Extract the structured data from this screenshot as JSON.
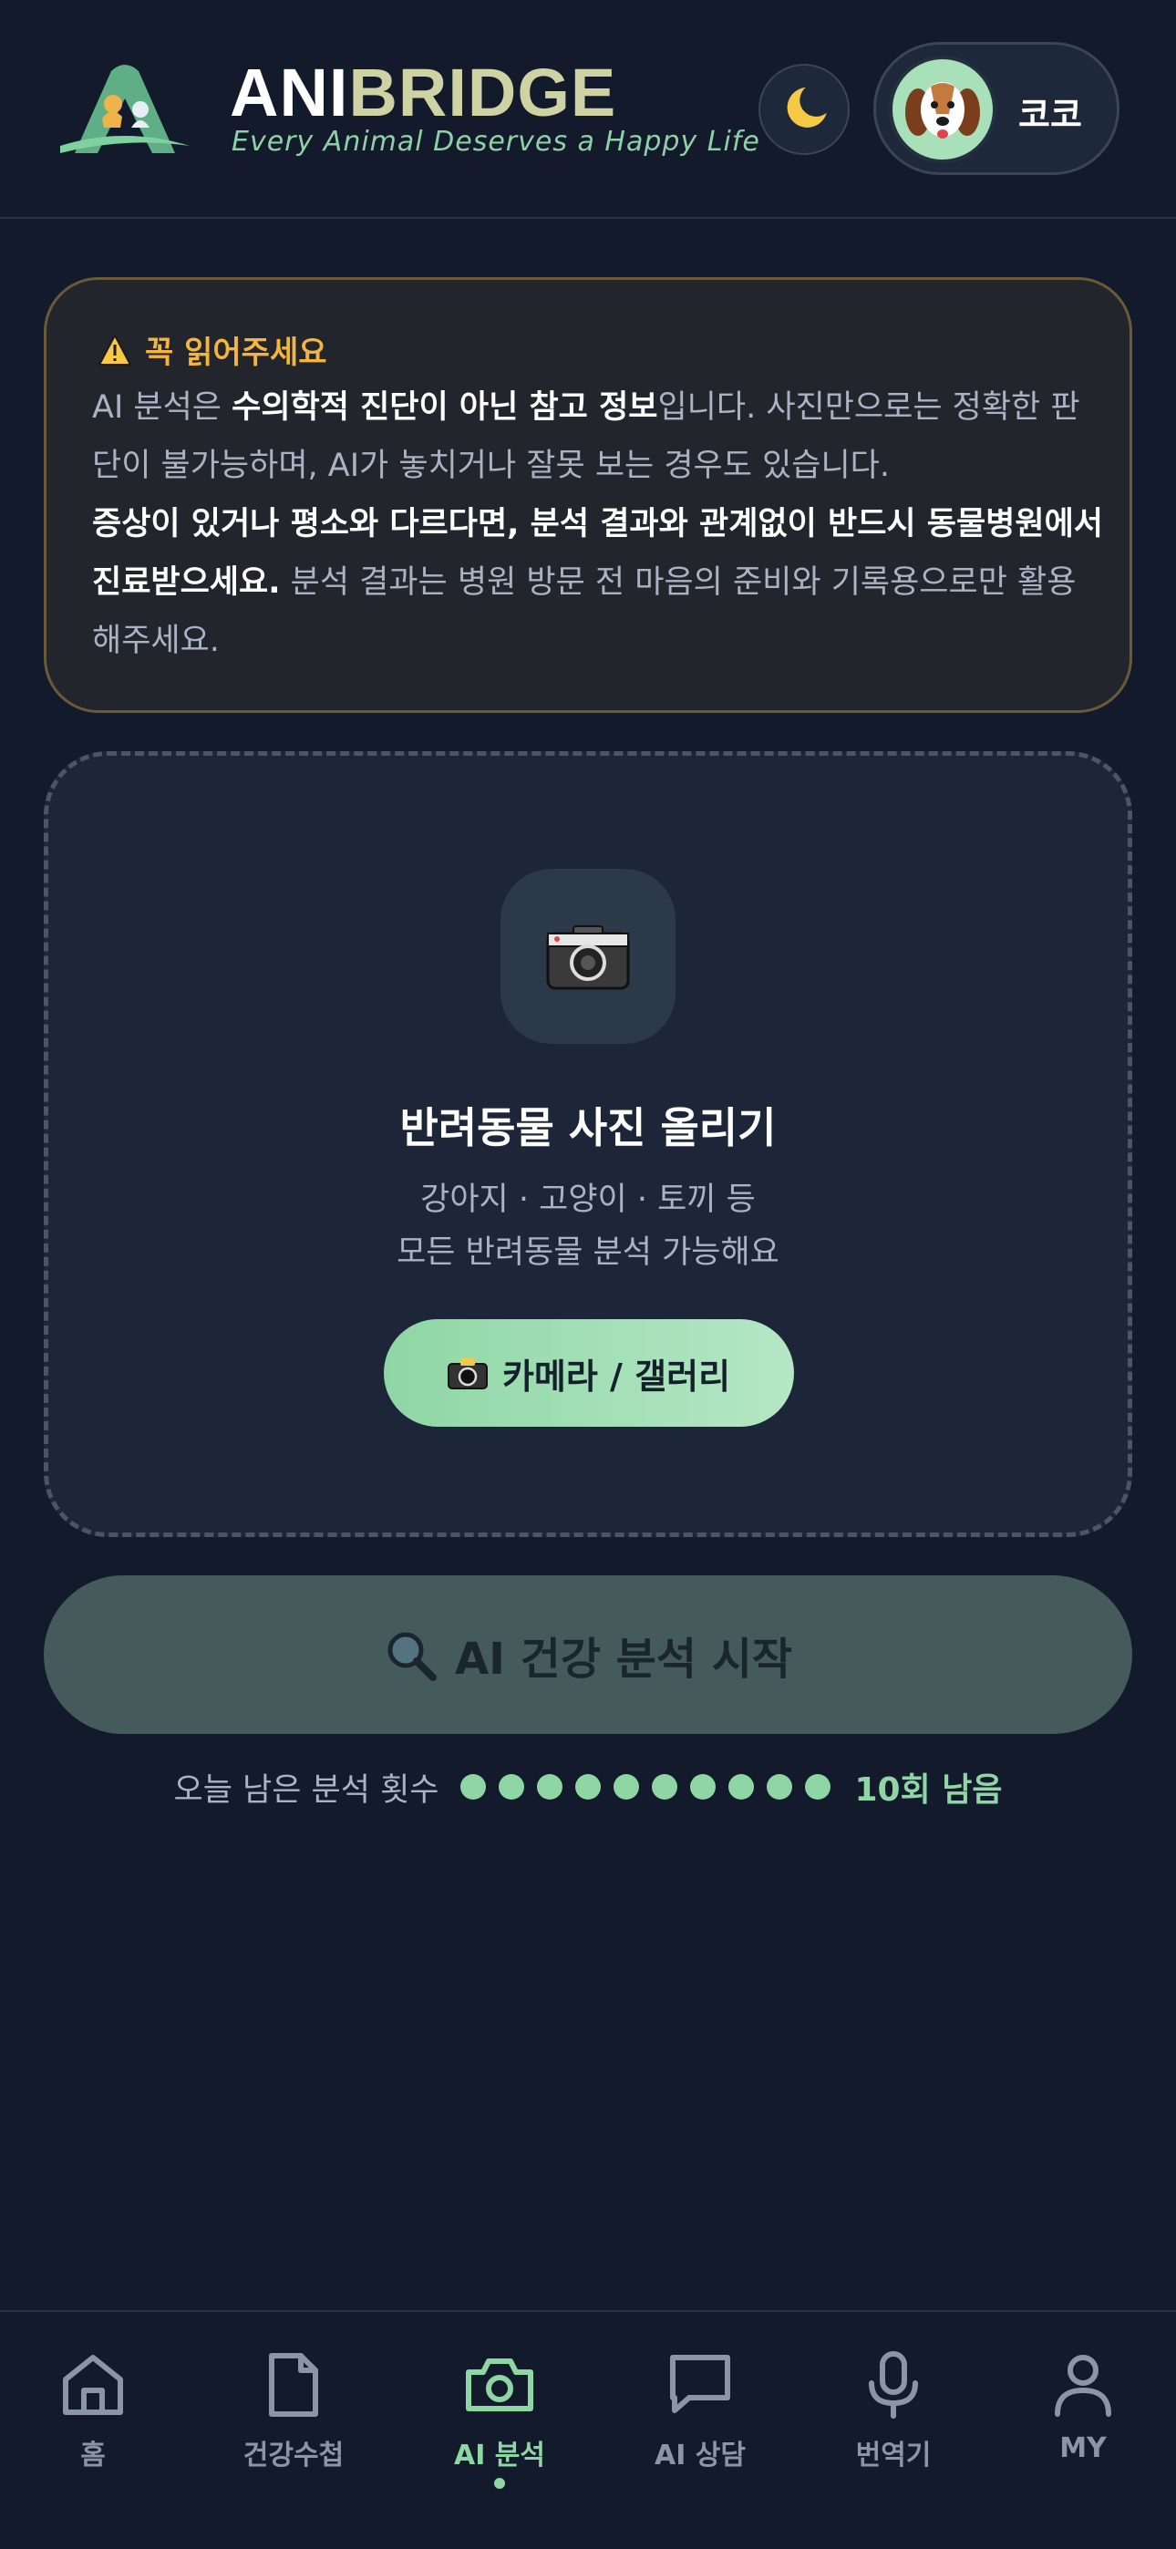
{
  "header": {
    "brand_part1": "ANI",
    "brand_part2": "BRIDGE",
    "tagline": "Every Animal Deserves a Happy Life",
    "theme_icon": "moon-icon",
    "profile_name": "코코"
  },
  "notice": {
    "title": "꼭 읽어주세요",
    "p1_a": "AI 분석은 ",
    "p1_b": "수의학적 진단이 아닌 참고 정보",
    "p1_c": "입니다. 사진만으로는 정확한 판단이 불가능하며, AI가 놓치거나 잘못 보는 경우도 있습니다.",
    "p2_a": "증상이 있거나 평소와 다르다면, 분석 결과와 관계없이 반드시 동물병원에서 진료받으세요.",
    "p2_b": " 분석 결과는 병원 방문 전 마음의 준비와 기록용으로만 활용해주세요.",
    "accent_color": "#f3b53e"
  },
  "upload": {
    "title": "반려동물 사진 올리기",
    "subtitle_line1": "강아지 · 고양이 · 토끼 등",
    "subtitle_line2": "모든 반려동물 분석 가능해요",
    "button_label": "카메라 / 갤러리"
  },
  "analyze_button": {
    "label": "AI 건강 분석 시작"
  },
  "quota": {
    "label": "오늘 남은 분석 횟수",
    "remaining_dots": 10,
    "count_text": "10회 남음"
  },
  "nav": {
    "items": [
      {
        "label": "홈",
        "icon": "home-icon",
        "active": false
      },
      {
        "label": "건강수첩",
        "icon": "document-icon",
        "active": false
      },
      {
        "label": "AI 분석",
        "icon": "camera-icon",
        "active": true
      },
      {
        "label": "AI 상담",
        "icon": "chat-icon",
        "active": false
      },
      {
        "label": "번역기",
        "icon": "microphone-icon",
        "active": false
      },
      {
        "label": "MY",
        "icon": "user-icon",
        "active": false
      }
    ]
  },
  "colors": {
    "background": "#121a2c",
    "accent_green": "#8fd6a5"
  }
}
